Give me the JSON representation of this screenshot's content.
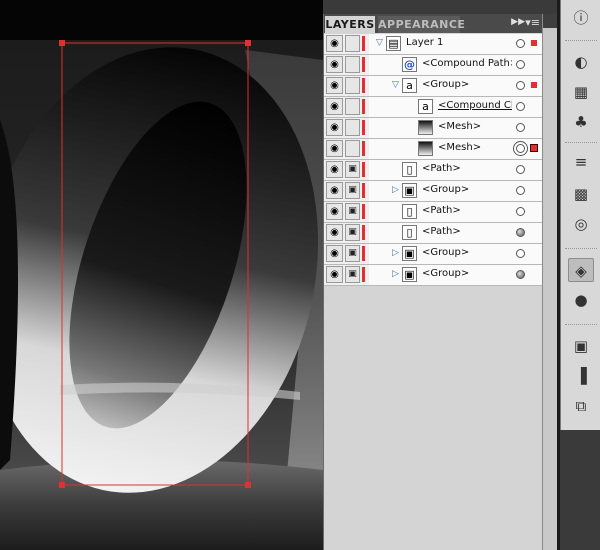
{
  "panel": {
    "tabs": [
      {
        "label": "LAYERS",
        "active": true
      },
      {
        "label": "APPEARANCE",
        "active": false
      }
    ],
    "forward_icon": "fast-forward-icon",
    "menu_icon": "panel-menu-icon"
  },
  "layers": [
    {
      "label": "Layer 1",
      "level": 0,
      "expander": "expanded",
      "locked": false,
      "selected": true,
      "target": "open",
      "thumb": "layer"
    },
    {
      "label": "<Compound Path>",
      "level": 1,
      "expander": "none",
      "locked": false,
      "selected": false,
      "target": "open",
      "thumb": "@"
    },
    {
      "label": "<Group>",
      "level": 1,
      "expander": "expanded",
      "locked": false,
      "selected": true,
      "target": "open",
      "thumb": "a"
    },
    {
      "label": "<Compound Cl...",
      "level": 2,
      "expander": "none",
      "locked": false,
      "selected": false,
      "target": "open",
      "thumb": "a",
      "underline": true
    },
    {
      "label": "<Mesh>",
      "level": 2,
      "expander": "none",
      "locked": false,
      "selected": false,
      "target": "open",
      "thumb": "mesh"
    },
    {
      "label": "<Mesh>",
      "level": 2,
      "expander": "none",
      "locked": false,
      "selected": true,
      "target": "ring",
      "thumb": "mesh"
    },
    {
      "label": "<Path>",
      "level": 1,
      "expander": "none",
      "locked": true,
      "selected": false,
      "target": "open",
      "thumb": "path"
    },
    {
      "label": "<Group>",
      "level": 1,
      "expander": "collapsed",
      "locked": true,
      "selected": false,
      "target": "open",
      "thumb": "group"
    },
    {
      "label": "<Path>",
      "level": 1,
      "expander": "none",
      "locked": true,
      "selected": false,
      "target": "open",
      "thumb": "path"
    },
    {
      "label": "<Path>",
      "level": 1,
      "expander": "none",
      "locked": true,
      "selected": false,
      "target": "filled",
      "thumb": "path"
    },
    {
      "label": "<Group>",
      "level": 1,
      "expander": "collapsed",
      "locked": true,
      "selected": false,
      "target": "open",
      "thumb": "group"
    },
    {
      "label": "<Group>",
      "level": 1,
      "expander": "collapsed",
      "locked": true,
      "selected": false,
      "target": "filled",
      "thumb": "group"
    }
  ],
  "dock": {
    "tools": [
      "info-icon",
      "color-palette-icon",
      "swatches-grid-icon",
      "symbols-club-icon",
      "stroke-icon",
      "gradient-icon",
      "transparency-icon",
      "layers-icon",
      "appearance-icon",
      "artboard-icon",
      "align-icon",
      "pathfinder-icon"
    ]
  },
  "colors": {
    "layer_color": "#e0302f",
    "selection": "#e0302f"
  }
}
